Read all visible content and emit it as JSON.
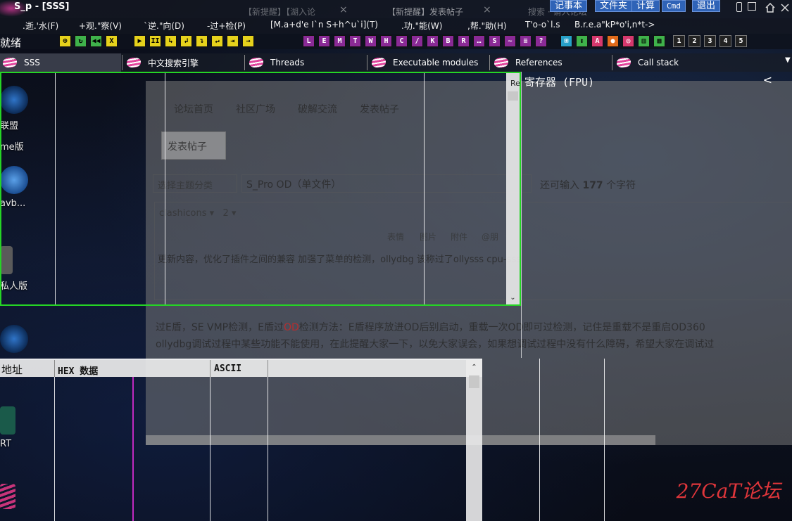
{
  "app": {
    "title": "S_p - [SSS]"
  },
  "ghost_tabs": [
    {
      "label": "【新提醒】【湖入论",
      "close": "×"
    },
    {
      "label": "【新提醒】发表帖子",
      "close": "×"
    },
    {
      "label": "搜索 · 请入论坛"
    }
  ],
  "quick_buttons": [
    "记事本",
    "文件夹",
    "计算",
    "Cmd",
    "退出"
  ],
  "menu": [
    ".逝.'水(F)",
    "+观.\"察(V)",
    "`逆.\"向(D)",
    "-过+检(P)",
    "[M.a+d'e I`n S+h^u`i](T)",
    ".功.\"能(W)",
    ",帮.\"助(H)",
    "T'o-o`l.s",
    "B.r.e.a\"kP*o'i,n*t->"
  ],
  "toolbar": {
    "status": "就绪",
    "buttons": [
      {
        "g": "⊕",
        "c": "y"
      },
      {
        "g": "↻",
        "c": "g"
      },
      {
        "g": "◀◀",
        "c": "g"
      },
      {
        "g": "X",
        "c": "y"
      },
      {
        "g": "▶",
        "c": "y"
      },
      {
        "g": "II",
        "c": "y"
      },
      {
        "g": "↳",
        "c": "y"
      },
      {
        "g": "↲",
        "c": "y"
      },
      {
        "g": "↴",
        "c": "y"
      },
      {
        "g": "↵",
        "c": "y"
      },
      {
        "g": "⇥",
        "c": "y"
      },
      {
        "g": "→",
        "c": "y"
      },
      {
        "g": "L",
        "c": "p"
      },
      {
        "g": "E",
        "c": "p"
      },
      {
        "g": "M",
        "c": "p"
      },
      {
        "g": "T",
        "c": "p"
      },
      {
        "g": "W",
        "c": "p"
      },
      {
        "g": "H",
        "c": "p"
      },
      {
        "g": "C",
        "c": "p"
      },
      {
        "g": "/",
        "c": "p"
      },
      {
        "g": "K",
        "c": "p"
      },
      {
        "g": "B",
        "c": "p"
      },
      {
        "g": "R",
        "c": "p"
      },
      {
        "g": "…",
        "c": "p"
      },
      {
        "g": "S",
        "c": "p"
      },
      {
        "g": "~",
        "c": "p"
      },
      {
        "g": "≡",
        "c": "p"
      },
      {
        "g": "?",
        "c": "p"
      },
      {
        "g": "⊞",
        "c": "c"
      },
      {
        "g": "↕",
        "c": "g"
      },
      {
        "g": "A",
        "c": "m"
      },
      {
        "g": "●",
        "c": "o"
      },
      {
        "g": "◎",
        "c": "m"
      },
      {
        "g": "▥",
        "c": "g"
      },
      {
        "g": "▦",
        "c": "g"
      },
      {
        "g": "1",
        "c": "k"
      },
      {
        "g": "2",
        "c": "k"
      },
      {
        "g": "3",
        "c": "k"
      },
      {
        "g": "4",
        "c": "k"
      },
      {
        "g": "5",
        "c": "k"
      }
    ]
  },
  "mdi_tabs": [
    "SSS",
    "中文搜索引擎",
    "Threads",
    "Executable modules",
    "References",
    "Call stack"
  ],
  "browser_bg": {
    "nav": [
      "论坛首页",
      "社区广场",
      "破解交流",
      "发表帖子"
    ],
    "tab": "发表帖子",
    "select": "选择主题分类",
    "subject": "S_Pro OD（单文件）",
    "count_prefix": "还可输入",
    "count_value": "177",
    "count_suffix": "个字符",
    "font": "clashicons",
    "font_size": "2",
    "tools": [
      "表情",
      "图片",
      "附件",
      "@朋"
    ],
    "body": "更新内容，优化了插件之间的兼容 加强了菜单的检测，ollydbg 该称过了ollysss   cpu-sss",
    "post1_a": "过E盾，SE VMP检测，E盾过",
    "post1_red": "OD",
    "post1_b": "检测方法：E盾程序放进OD后别启动，重载一次OD即可过检测，记住是重载不是重启OD360",
    "post2": "ollydbg调试过程中某些功能不能使用，在此提醒大家一下，以免大家误会，如果想调试过程中没有什么障碍，希望大家在调试过"
  },
  "registers": {
    "title": "寄存器 (FPU)",
    "small_label": "Re",
    "collapse": "<"
  },
  "dump": {
    "col_address": "地址",
    "col_hex": "HEX 数据",
    "col_ascii": "ASCII"
  },
  "desktop_icons": [
    "联盟",
    "me版",
    "avb...",
    "私人版",
    "RT"
  ],
  "watermark": "27CaT论坛",
  "colors": {
    "pane_border": "#25d425",
    "quick_button": "#2f63b7",
    "accent_pink": "#e0449c"
  }
}
